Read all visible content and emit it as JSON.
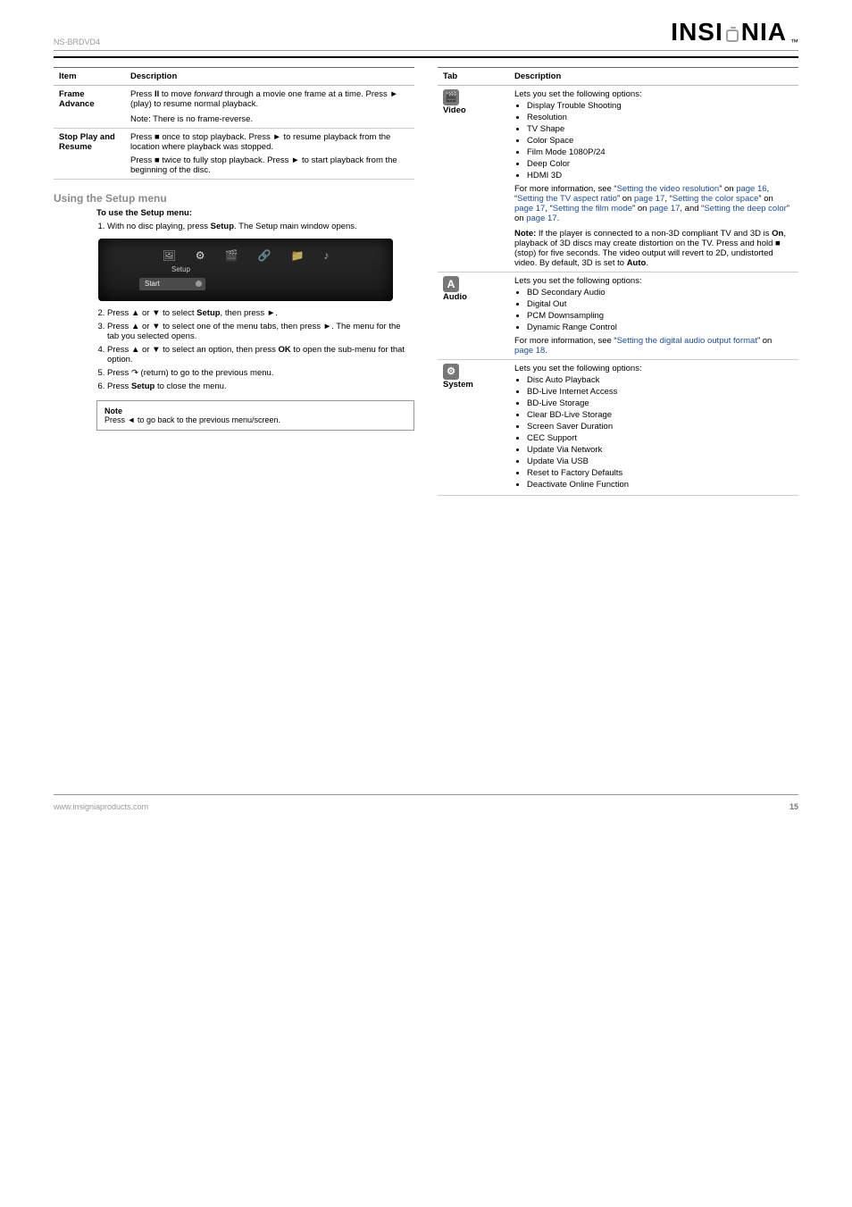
{
  "header": {
    "product": "NS-BRDVD4",
    "brand": "INSIGNIA",
    "tm": "™"
  },
  "left": {
    "table1": {
      "head_item": "Item",
      "head_desc": "Description",
      "row1": {
        "item": "Frame Advance",
        "desc_lead": "Press ",
        "desc_key": "II",
        "desc_mid": " to move ",
        "desc_em": "forward",
        "desc_tail": " through a movie one frame at a time. Press ► (play) to resume normal playback.",
        "note": "Note: There is no frame-reverse."
      },
      "row2": {
        "item": "Stop Play and Resume",
        "desc_p1a": "Press ",
        "desc_p1b": " once to stop playback. Press ► to resume playback from the location where playback was stopped.",
        "desc_p2a": "Press ",
        "desc_p2b": " twice to fully stop playback. Press ► to start playback from the beginning of the disc."
      }
    },
    "section": "Using the Setup menu",
    "setup_line1": "To use the Setup menu:",
    "setup_line2a": "With no disc playing, press ",
    "setup_line2b": "Setup",
    "setup_line2c": ". The Setup main window opens.",
    "osd": {
      "label": "Setup",
      "start": "Start"
    },
    "steps": {
      "s2a": "Press ",
      "s2b": " or ",
      "s2c": " to select ",
      "s2d": "Setup",
      "s2e": ", then press ",
      "s2f": ".",
      "s3a": "Press ",
      "s3b": " or ",
      "s3c": " to select one of the menu tabs, then press ",
      "s3d": ". The menu for the tab you selected opens.",
      "s4a": "Press ",
      "s4b": " or ",
      "s4c": " to select an option, then press ",
      "s4d": "OK",
      "s4e": " to open the sub-menu for that option.",
      "s5a": "Press ",
      "s5b": " (return) to go to the previous menu.",
      "s6a": "Press ",
      "s6b": "Setup",
      "s6c": " to close the menu."
    },
    "note_label": "Note",
    "note_body_a": "Press ",
    "note_body_b": " to go back to the previous menu/screen."
  },
  "right": {
    "table": {
      "head_tab": "Tab",
      "head_desc": "Description",
      "video": {
        "tab": "Video",
        "title": "Lets you set the following options:",
        "items": [
          "Display Trouble Shooting",
          "Resolution",
          "TV Shape",
          "Color Space",
          "Film Mode 1080P/24",
          "Deep Color",
          "HDMI 3D"
        ],
        "more_a": "For more information, see “",
        "more_link1": "Setting the video resolution",
        "more_b": "” on ",
        "more_link2": "page 16",
        "more_c": ", “",
        "more_link3": "Setting the TV aspect ratio",
        "more_d": "” on ",
        "more_link4": "page 17",
        "more_e": ", “",
        "more_link5": "Setting the color space",
        "more_f": "” on ",
        "more_link6": "page 17",
        "more_g": ", “",
        "more_link7": "Setting the film mode",
        "more_h": "” on ",
        "more_link8": "page 17",
        "more_i": ", and “",
        "more_link9": "Setting the deep color",
        "more_j": "” on ",
        "more_link10": "page 17",
        "more_k": ".",
        "note_lead": "Note: ",
        "note_a": "If the player is connected to a non-3D compliant TV and 3D is ",
        "note_b": "On",
        "note_c": ", playback of 3D discs may create distortion on the TV. Press and hold ",
        "note_d": " (stop) for five seconds. The video output will revert to 2D, undistorted video. By default, 3D is set to ",
        "note_e": "Auto",
        "note_f": "."
      },
      "audio": {
        "tab": "Audio",
        "title": "Lets you set the following options:",
        "items": [
          "BD Secondary Audio",
          "Digital Out",
          "PCM Downsampling",
          "Dynamic Range Control"
        ],
        "more_a": "For more information, see “",
        "more_link1": "Setting the digital audio output format",
        "more_b": "” on ",
        "more_link2": "page 18",
        "more_c": "."
      },
      "system": {
        "tab": "System",
        "title": "Lets you set the following options:",
        "items": [
          "Disc Auto Playback",
          "BD-Live Internet Access",
          "BD-Live Storage",
          "Clear BD-Live Storage",
          "Screen Saver Duration",
          "CEC Support",
          "Update Via Network",
          "Update Via USB",
          "Reset to Factory Defaults",
          "Deactivate Online Function"
        ]
      }
    }
  },
  "footer": {
    "url": "www.insigniaproducts.com",
    "page": "15"
  }
}
